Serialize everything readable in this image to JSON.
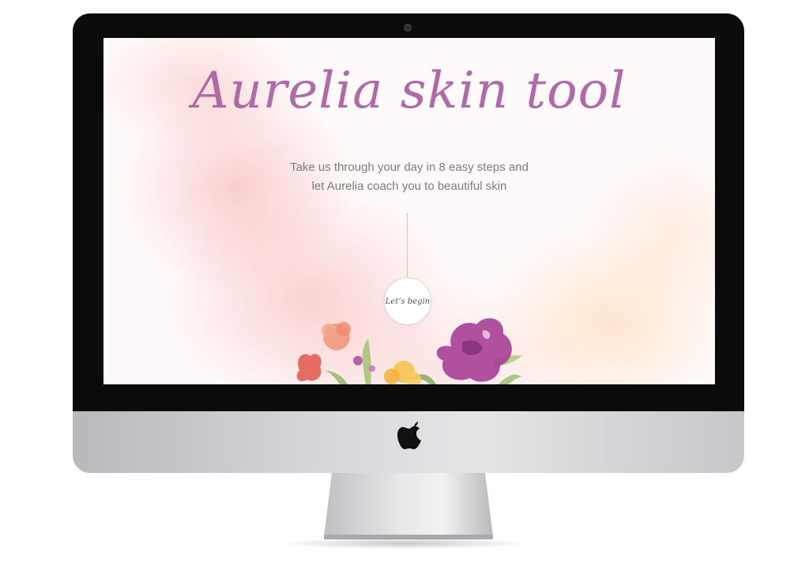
{
  "hero": {
    "title": "Aurelia skin tool",
    "subtitle_line1": "Take us through your day in 8 easy steps and",
    "subtitle_line2": "let  Aurelia coach you to beautiful skin",
    "cta_label": "Let’s begin"
  },
  "icons": {
    "brand_logo": "apple-logo-icon",
    "camera": "camera-icon",
    "decoration": "watercolor-flowers-icon"
  },
  "colors": {
    "title": "#b06aa7",
    "subtitle": "#7c7c7c",
    "bezel": "#0b0b0b"
  }
}
